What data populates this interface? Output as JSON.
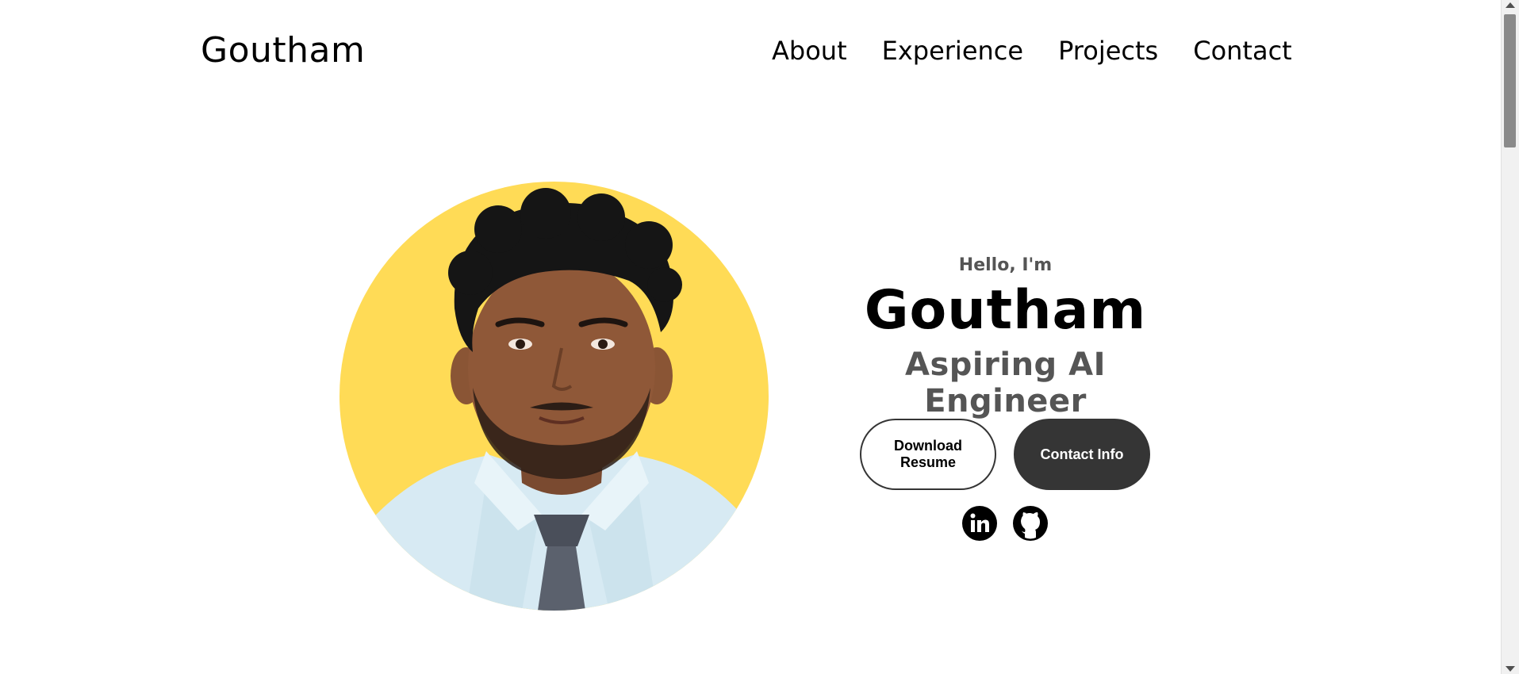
{
  "nav": {
    "logo": "Goutham",
    "links": [
      "About",
      "Experience",
      "Projects",
      "Contact"
    ]
  },
  "hero": {
    "greeting": "Hello, I'm",
    "name": "Goutham",
    "title": "Aspiring AI Engineer",
    "buttons": {
      "resume": "Download Resume",
      "contact": "Contact Info"
    },
    "socials": [
      "linkedin-icon",
      "github-icon"
    ]
  },
  "colors": {
    "profile_bg": "#ffdb56",
    "button_dark": "#353535",
    "subtitle_gray": "#555555"
  }
}
